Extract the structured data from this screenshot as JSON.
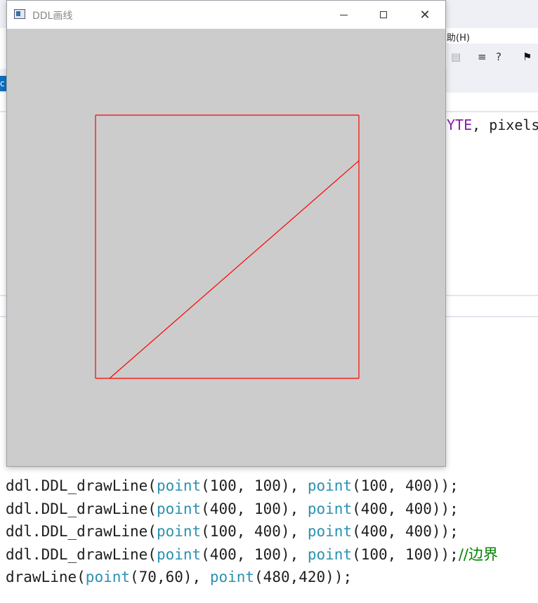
{
  "ide": {
    "menu_fragment": "助(H)",
    "code_fragment_keyword": "YTE",
    "code_fragment_rest": ", pixels"
  },
  "window": {
    "title": "DDL画线"
  },
  "canvas": {
    "background": "#cccccc",
    "line_color": "#ff0000",
    "icons": {
      "app": "app-icon",
      "minimize": "minimize-icon",
      "maximize": "maximize-icon",
      "close": "close-icon"
    }
  },
  "code": {
    "lines": [
      [
        {
          "t": "ddl.DDL_drawLine("
        },
        {
          "t": "point",
          "c": "fn"
        },
        {
          "t": "(100, 100), "
        },
        {
          "t": "point",
          "c": "fn"
        },
        {
          "t": "(100, 400));"
        }
      ],
      [
        {
          "t": "ddl.DDL_drawLine("
        },
        {
          "t": "point",
          "c": "fn"
        },
        {
          "t": "(400, 100), "
        },
        {
          "t": "point",
          "c": "fn"
        },
        {
          "t": "(400, 400));"
        }
      ],
      [
        {
          "t": "ddl.DDL_drawLine("
        },
        {
          "t": "point",
          "c": "fn"
        },
        {
          "t": "(100, 400), "
        },
        {
          "t": "point",
          "c": "fn"
        },
        {
          "t": "(400, 400));"
        }
      ],
      [
        {
          "t": "ddl.DDL_drawLine("
        },
        {
          "t": "point",
          "c": "fn"
        },
        {
          "t": "(400, 100), "
        },
        {
          "t": "point",
          "c": "fn"
        },
        {
          "t": "(100, 100));"
        },
        {
          "t": "//边界",
          "c": "cm"
        }
      ],
      [
        {
          "t": "drawLine("
        },
        {
          "t": "point",
          "c": "fn"
        },
        {
          "t": "(70,60), "
        },
        {
          "t": "point",
          "c": "fn"
        },
        {
          "t": "(480,420));"
        }
      ]
    ]
  }
}
